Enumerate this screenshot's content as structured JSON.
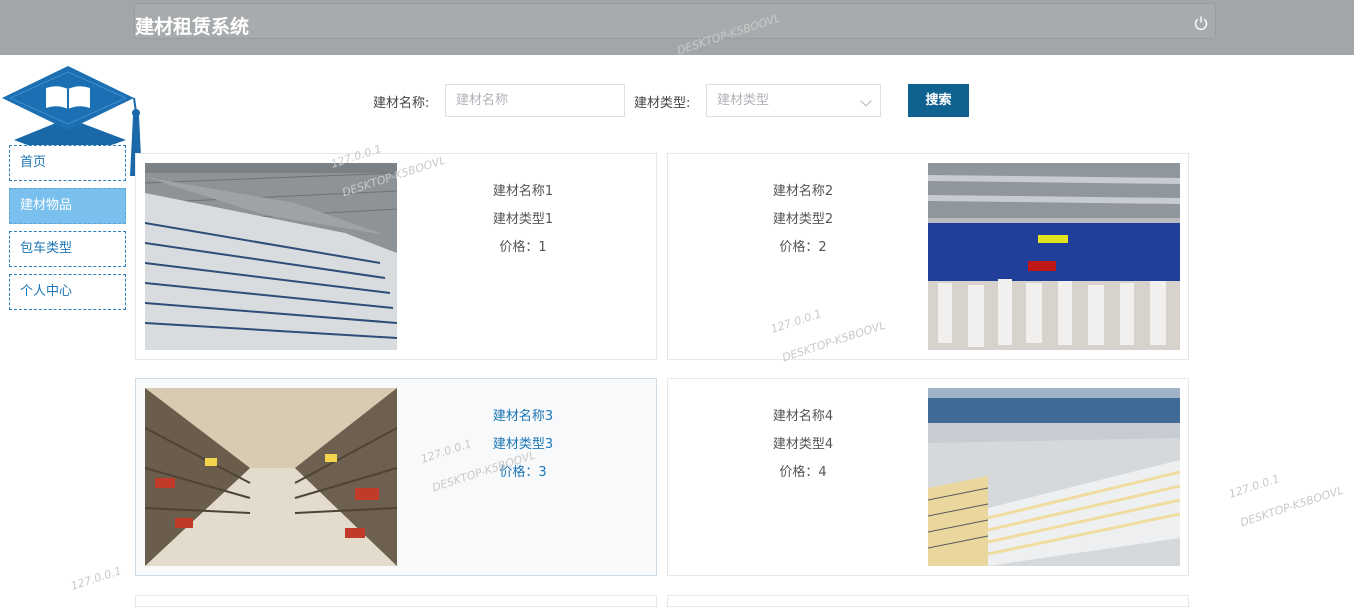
{
  "header": {
    "title": "建材租赁系统",
    "power_icon": "power-icon"
  },
  "logo": {
    "icon": "book-cap-icon"
  },
  "sidebar": {
    "items": [
      {
        "label": "首页",
        "active": false
      },
      {
        "label": "建材物品",
        "active": true
      },
      {
        "label": "包车类型",
        "active": false
      },
      {
        "label": "个人中心",
        "active": false
      }
    ]
  },
  "search": {
    "name_label": "建材名称:",
    "name_placeholder": "建材名称",
    "type_label": "建材类型:",
    "type_placeholder": "建材类型",
    "button_label": "搜索"
  },
  "items": [
    {
      "name": "建材名称1",
      "type": "建材类型1",
      "price": "价格：1"
    },
    {
      "name": "建材名称2",
      "type": "建材类型2",
      "price": "价格：2"
    },
    {
      "name": "建材名称3",
      "type": "建材类型3",
      "price": "价格：3"
    },
    {
      "name": "建材名称4",
      "type": "建材类型4",
      "price": "价格：4"
    }
  ],
  "watermark": {
    "ip": "127.0.0.1",
    "host": "DESKTOP-K5BOOVL"
  }
}
